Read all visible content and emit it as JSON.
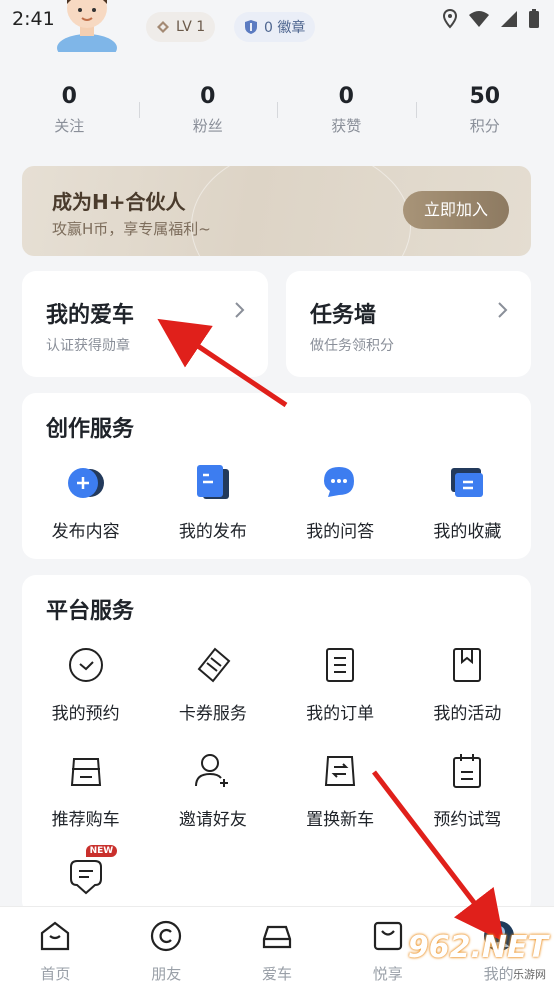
{
  "status_bar": {
    "time": "2:41"
  },
  "profile": {
    "level_badge": "LV 1",
    "medal_badge": "0 徽章"
  },
  "stats": [
    {
      "value": "0",
      "label": "关注"
    },
    {
      "value": "0",
      "label": "粉丝"
    },
    {
      "value": "0",
      "label": "获赞"
    },
    {
      "value": "50",
      "label": "积分"
    }
  ],
  "partner_banner": {
    "title": "成为H+合伙人",
    "subtitle": "攻赢H币，享专属福利~",
    "button": "立即加入"
  },
  "quick_cards": {
    "my_car": {
      "title": "我的爱车",
      "subtitle": "认证获得勋章"
    },
    "task_wall": {
      "title": "任务墙",
      "subtitle": "做任务领积分"
    }
  },
  "creation_services": {
    "title": "创作服务",
    "items": [
      {
        "label": "发布内容",
        "icon": "add-circle-icon"
      },
      {
        "label": "我的发布",
        "icon": "document-icon"
      },
      {
        "label": "我的问答",
        "icon": "chat-bubble-icon"
      },
      {
        "label": "我的收藏",
        "icon": "collection-icon"
      }
    ]
  },
  "platform_services": {
    "title": "平台服务",
    "new_tag": "NEW",
    "items": [
      {
        "label": "我的预约",
        "icon": "clock-icon"
      },
      {
        "label": "卡券服务",
        "icon": "ticket-icon"
      },
      {
        "label": "我的订单",
        "icon": "order-icon"
      },
      {
        "label": "我的活动",
        "icon": "bookmark-icon"
      },
      {
        "label": "推荐购车",
        "icon": "car-front-icon"
      },
      {
        "label": "邀请好友",
        "icon": "add-user-icon"
      },
      {
        "label": "置换新车",
        "icon": "car-exchange-icon"
      },
      {
        "label": "预约试驾",
        "icon": "calendar-icon"
      }
    ]
  },
  "tab_bar": [
    {
      "label": "首页",
      "icon": "home-icon"
    },
    {
      "label": "朋友",
      "icon": "friends-icon"
    },
    {
      "label": "爱车",
      "icon": "car-icon"
    },
    {
      "label": "悦享",
      "icon": "shop-bag-icon"
    },
    {
      "label": "我的",
      "icon": "profile-icon"
    }
  ],
  "watermark": {
    "logo_text": "962.NET",
    "caption": "乐游网"
  },
  "colors": {
    "accent_blue": "#3d7df0",
    "arrow_red": "#e0201b",
    "partner_gold": "#9c8a70"
  }
}
